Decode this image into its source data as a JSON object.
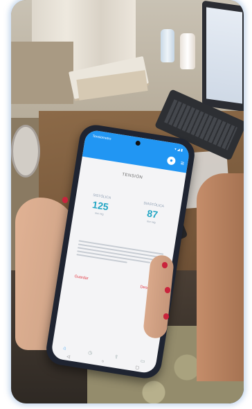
{
  "app": {
    "title": "Tensiómetro",
    "status_icons": "▾ ◢ ▮",
    "screen_title": "TENSIÓN"
  },
  "metrics": [
    {
      "label": "SISTÓLICA",
      "value": "125",
      "unit": "mm Hg"
    },
    {
      "label": "DIASTÓLICA",
      "value": "87",
      "unit": "mm Hg"
    }
  ],
  "actions": {
    "left": "Guardar",
    "right": "Descartar"
  },
  "icons": {
    "avatar": "account-icon",
    "menu": "menu-icon",
    "nav": [
      "home-icon",
      "history-icon",
      "share-icon",
      "settings-icon"
    ]
  },
  "colors": {
    "appbar": "#2196f3",
    "value": "#23a6c4",
    "action": "#e2343f",
    "frame_glow": "#5a8cc8"
  }
}
